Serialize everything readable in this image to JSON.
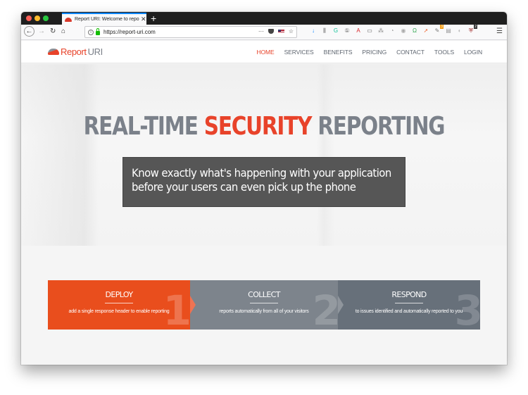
{
  "browser": {
    "tab_title": "Report URI: Welcome to report-uri",
    "tab_close": "✕",
    "new_tab": "+",
    "url": "https://report-uri.com",
    "nav": {
      "back": "←",
      "forward": "→",
      "reload": "↻",
      "home": "⌂"
    },
    "url_actions": {
      "more": "···",
      "bookmark": "☆"
    },
    "extensions": [
      {
        "name": "download",
        "glyph": "↓",
        "color": "#0a84ff"
      },
      {
        "name": "library",
        "glyph": "⫼",
        "color": "#555555"
      },
      {
        "name": "grammarly",
        "glyph": "G",
        "color": "#15c39a"
      },
      {
        "name": "1password",
        "glyph": "①",
        "color": "#555555"
      },
      {
        "name": "acrobat",
        "glyph": "A",
        "color": "#d9262b"
      },
      {
        "name": "reader",
        "glyph": "▭",
        "color": "#555555"
      },
      {
        "name": "extension-7",
        "glyph": "⁂",
        "color": "#777777"
      },
      {
        "name": "extension-8",
        "glyph": "◔",
        "color": "#999999"
      },
      {
        "name": "extension-9",
        "glyph": "◉",
        "color": "#aaaaaa"
      },
      {
        "name": "extension-10",
        "glyph": "Ω",
        "color": "#34a853"
      },
      {
        "name": "extension-11",
        "glyph": "➚",
        "color": "#f0652f"
      },
      {
        "name": "extension-12",
        "glyph": "✎",
        "color": "#777777",
        "badge": "3"
      },
      {
        "name": "extension-13",
        "glyph": "▤",
        "color": "#999999"
      },
      {
        "name": "extension-14",
        "glyph": "◐",
        "color": "#bbbbbb"
      },
      {
        "name": "extension-15",
        "glyph": "⛨",
        "color": "#9b1c1c",
        "badge": "2"
      }
    ],
    "menu": "☰"
  },
  "site": {
    "logo": {
      "report": "Report",
      "uri": "URI"
    },
    "nav": [
      {
        "label": "HOME",
        "active": true
      },
      {
        "label": "SERVICES"
      },
      {
        "label": "BENEFITS"
      },
      {
        "label": "PRICING"
      },
      {
        "label": "CONTACT"
      },
      {
        "label": "TOOLS"
      },
      {
        "label": "LOGIN"
      }
    ],
    "hero": {
      "title_pre": "REAL-TIME ",
      "title_accent": "SECURITY",
      "title_post": " REPORTING",
      "line1": "Know exactly what's happening with your application",
      "line2": "before your users can even pick up the phone"
    },
    "steps": [
      {
        "title": "DEPLOY",
        "description": "add a single response header to enable reporting",
        "number": "1"
      },
      {
        "title": "COLLECT",
        "description": "reports automatically from all of your visitors",
        "number": "2"
      },
      {
        "title": "RESPOND",
        "description": "to issues identified and automatically reported to you",
        "number": "3"
      }
    ],
    "colors": {
      "accent": "#e8432a",
      "deploy": "#e94e1d",
      "collect": "#7d848c",
      "respond": "#67707a"
    }
  }
}
